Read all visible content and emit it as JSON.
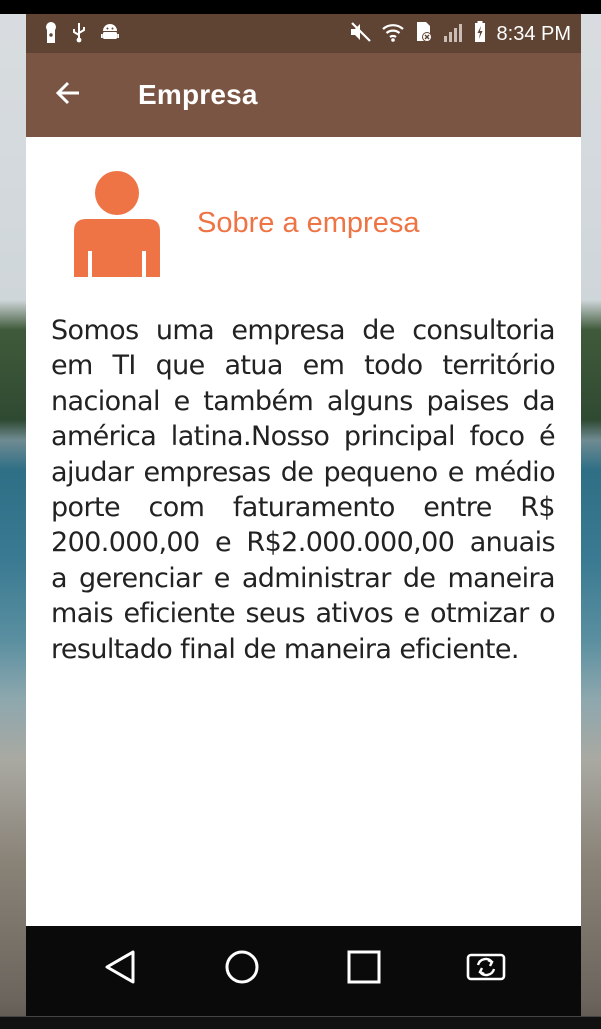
{
  "status_bar": {
    "time": "8:34 PM",
    "icons_left": [
      "keyhole-icon",
      "usb-icon",
      "android-icon"
    ],
    "icons_right": [
      "mute-icon",
      "wifi-icon",
      "sim-icon",
      "signal-icon",
      "battery-icon"
    ]
  },
  "app_bar": {
    "title": "Empresa",
    "back_icon": "arrow-left-icon",
    "color": "#7a5543"
  },
  "content": {
    "icon": "person-icon",
    "icon_color": "#ee7445",
    "section_title": "Sobre a empresa",
    "description": "Somos uma empresa de consultoria em TI que atua em todo território nacional e também alguns paises da américa latina.Nosso principal foco é ajudar empresas de pequeno e médio porte com faturamento entre R$ 200.000,00 e R$2.000.000,00 anuais a gerenciar e administrar de maneira mais eficiente seus ativos e otmizar o resultado final de maneira eficiente."
  },
  "nav_bar": {
    "buttons": [
      "back-triangle-icon",
      "home-circle-icon",
      "recents-square-icon",
      "screen-rotate-icon"
    ]
  }
}
